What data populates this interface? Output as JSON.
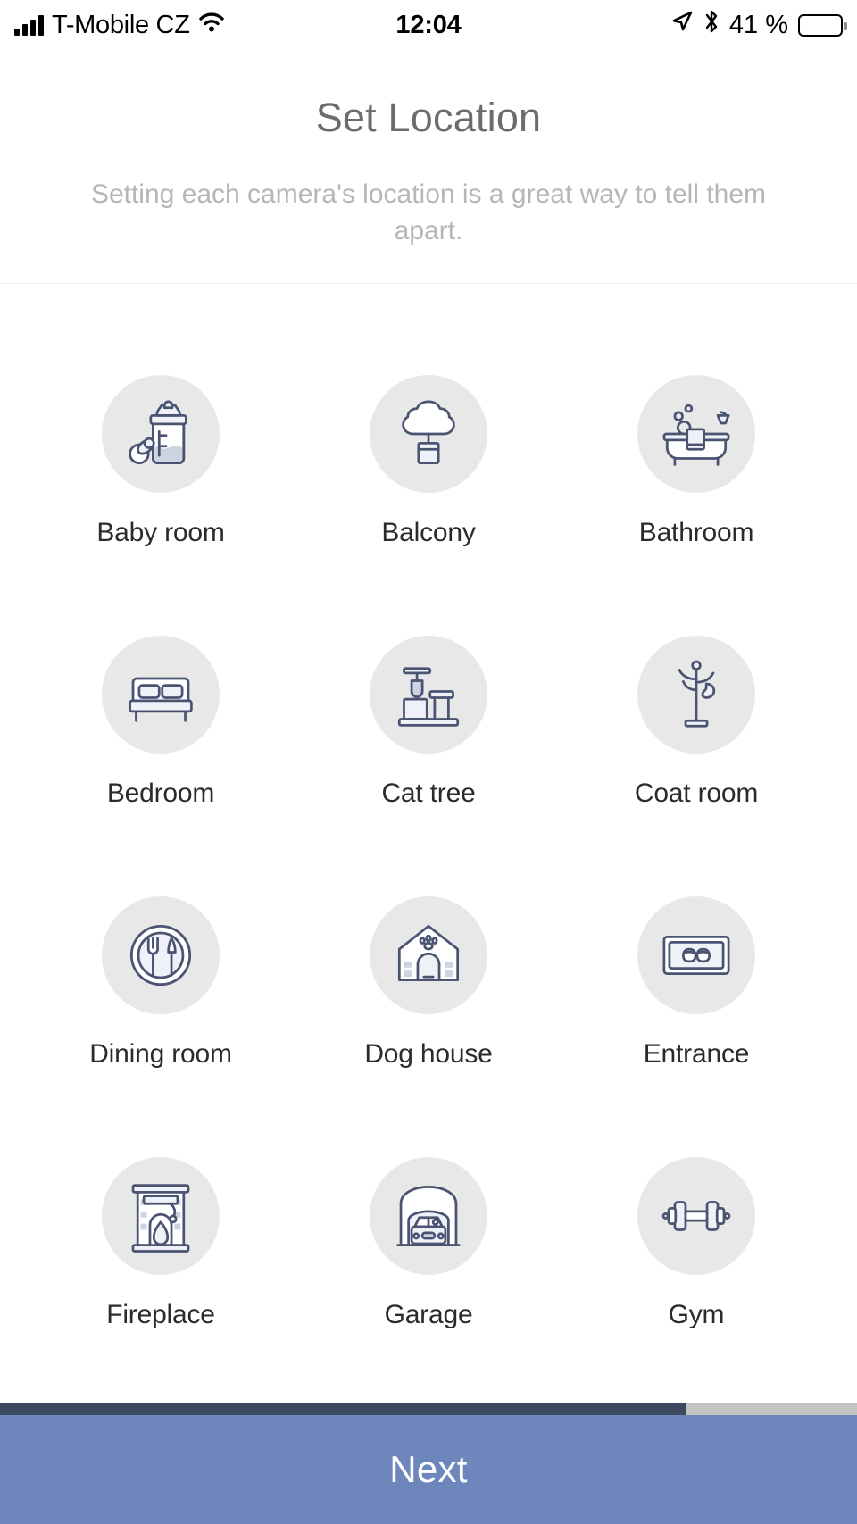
{
  "status_bar": {
    "carrier": "T-Mobile CZ",
    "time": "12:04",
    "battery_percent": "41 %",
    "signal_icon": "cellular-bars-icon",
    "wifi_icon": "wifi-icon",
    "location_icon": "location-arrow-icon",
    "bluetooth_icon": "bluetooth-icon",
    "battery_icon": "battery-icon",
    "battery_level": 41
  },
  "header": {
    "title": "Set Location",
    "subtitle": "Setting each camera's location is a great way to tell them apart."
  },
  "locations": [
    {
      "label": "Baby room",
      "icon": "baby-bottle-icon"
    },
    {
      "label": "Balcony",
      "icon": "potted-tree-icon"
    },
    {
      "label": "Bathroom",
      "icon": "bathtub-icon"
    },
    {
      "label": "Bedroom",
      "icon": "bed-icon"
    },
    {
      "label": "Cat tree",
      "icon": "cat-tree-icon"
    },
    {
      "label": "Coat room",
      "icon": "coat-rack-icon"
    },
    {
      "label": "Dining room",
      "icon": "plate-fork-knife-icon"
    },
    {
      "label": "Dog house",
      "icon": "dog-house-icon"
    },
    {
      "label": "Entrance",
      "icon": "doormat-slippers-icon"
    },
    {
      "label": "Fireplace",
      "icon": "fireplace-icon"
    },
    {
      "label": "Garage",
      "icon": "garage-car-icon"
    },
    {
      "label": "Gym",
      "icon": "dumbbell-icon"
    }
  ],
  "footer": {
    "next_label": "Next",
    "progress_percent": 80,
    "progress_fill_color": "#3b4a5f",
    "progress_track_color": "#c3c3c3",
    "button_color": "#6d87bd"
  },
  "colors": {
    "bubble_bg": "#e8e8e8",
    "title": "#6c6c6c",
    "subtitle": "#b3b6ba",
    "label": "#2b2b2b",
    "icon_stroke": "#4a5472"
  }
}
